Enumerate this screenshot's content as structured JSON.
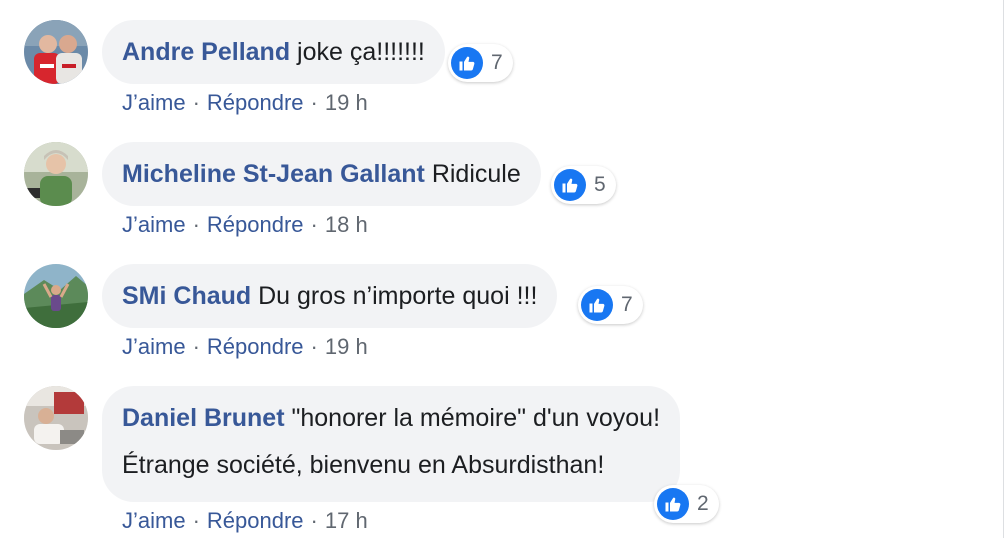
{
  "colors": {
    "author_link": "#385898",
    "action_link": "#385898",
    "muted_text": "#606770",
    "bubble_bg": "#f2f3f5",
    "like_blue": "#1877f2"
  },
  "separator": "·",
  "comments": [
    {
      "author": "Andre Pelland",
      "text": "joke ça!!!!!!!",
      "like_count": "7",
      "like_label": "J’aime",
      "reply_label": "Répondre",
      "time": "19 h"
    },
    {
      "author": "Micheline St-Jean Gallant",
      "text": "Ridicule",
      "like_count": "5",
      "like_label": "J’aime",
      "reply_label": "Répondre",
      "time": "18 h"
    },
    {
      "author": "SMi Chaud",
      "text": "Du gros n’importe quoi !!!",
      "like_count": "7",
      "like_label": "J’aime",
      "reply_label": "Répondre",
      "time": "19 h"
    },
    {
      "author": "Daniel Brunet",
      "text": "\"honorer la mémoire\" d'un voyou!",
      "text_line2": "Étrange société, bienvenu en Absurdisthan!",
      "like_count": "2",
      "like_label": "J’aime",
      "reply_label": "Répondre",
      "time": "17 h"
    }
  ]
}
